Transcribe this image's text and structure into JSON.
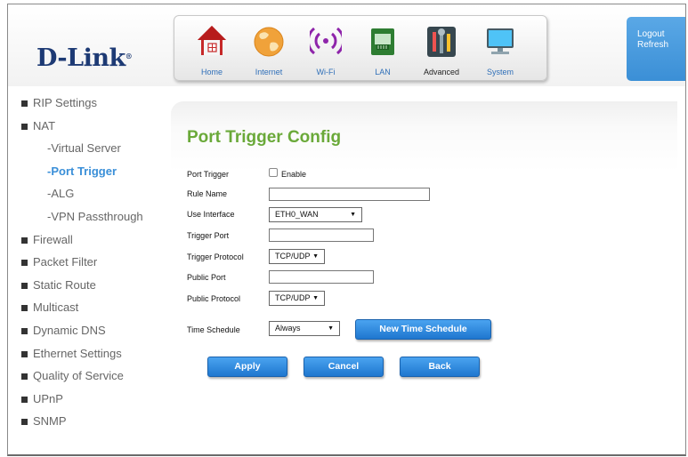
{
  "brand": {
    "logo": "D-Link",
    "registered": "®"
  },
  "nav": [
    {
      "label": "Home",
      "icon": "home-icon"
    },
    {
      "label": "Internet",
      "icon": "globe-icon"
    },
    {
      "label": "Wi-Fi",
      "icon": "wifi-icon"
    },
    {
      "label": "LAN",
      "icon": "lan-icon"
    },
    {
      "label": "Advanced",
      "icon": "tools-icon"
    },
    {
      "label": "System",
      "icon": "monitor-icon"
    }
  ],
  "account": {
    "logout": "Logout",
    "refresh": "Refresh"
  },
  "sidebar": {
    "items": [
      {
        "label": "RIP Settings"
      },
      {
        "label": "NAT"
      },
      {
        "label": "-Virtual Server"
      },
      {
        "label": "-Port Trigger",
        "active": true
      },
      {
        "label": "-ALG"
      },
      {
        "label": "-VPN Passthrough"
      },
      {
        "label": "Firewall"
      },
      {
        "label": "Packet Filter"
      },
      {
        "label": "Static Route"
      },
      {
        "label": "Multicast"
      },
      {
        "label": "Dynamic DNS"
      },
      {
        "label": "Ethernet Settings"
      },
      {
        "label": "Quality of Service"
      },
      {
        "label": "UPnP"
      },
      {
        "label": "SNMP"
      }
    ]
  },
  "main": {
    "title": "Port Trigger Config",
    "form": {
      "port_trigger_label": "Port Trigger",
      "enable_label": "Enable",
      "enable_checked": false,
      "rule_name_label": "Rule Name",
      "rule_name_value": "",
      "use_interface_label": "Use Interface",
      "use_interface_value": "ETH0_WAN",
      "trigger_port_label": "Trigger Port",
      "trigger_port_value": "",
      "trigger_protocol_label": "Trigger Protocol",
      "trigger_protocol_value": "TCP/UDP",
      "public_port_label": "Public Port",
      "public_port_value": "",
      "public_protocol_label": "Public Protocol",
      "public_protocol_value": "TCP/UDP",
      "time_schedule_label": "Time Schedule",
      "time_schedule_value": "Always",
      "new_time_schedule_label": "New Time Schedule"
    },
    "buttons": {
      "apply": "Apply",
      "cancel": "Cancel",
      "back": "Back"
    }
  },
  "colors": {
    "title_green": "#6aa939",
    "accent_blue": "#2f80d6",
    "active_link": "#3a8fd8"
  }
}
